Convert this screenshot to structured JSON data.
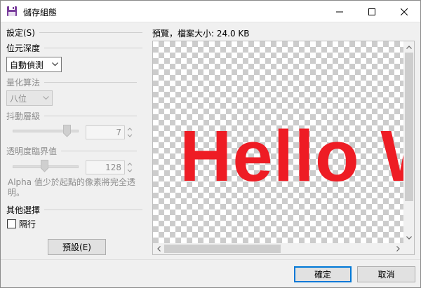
{
  "window": {
    "title": "儲存組態"
  },
  "settings": {
    "header": "設定(S)",
    "bit_depth": {
      "label": "位元深度",
      "value": "自動偵測"
    },
    "quantization": {
      "label": "量化算法",
      "value": "八位"
    },
    "dithering": {
      "label": "抖動層級",
      "value": "7",
      "level": 7
    },
    "transparency": {
      "label": "透明度臨界值",
      "value": "128",
      "level": 128
    },
    "alpha_note": "Alpha 值少於起點的像素將完全透明。",
    "other": {
      "label": "其他選擇",
      "interlace_label": "隔行",
      "interlace_checked": false
    },
    "defaults_button": "預設(E)"
  },
  "preview": {
    "label": "預覽，檔案大小: 24.0 KB",
    "image_text": "Hello W",
    "text_color": "#ee1c24"
  },
  "footer": {
    "ok_label": "確定",
    "cancel_label": "取消"
  },
  "colors": {
    "accent": "#0078d7",
    "brand_icon": "#7a3e9d"
  }
}
